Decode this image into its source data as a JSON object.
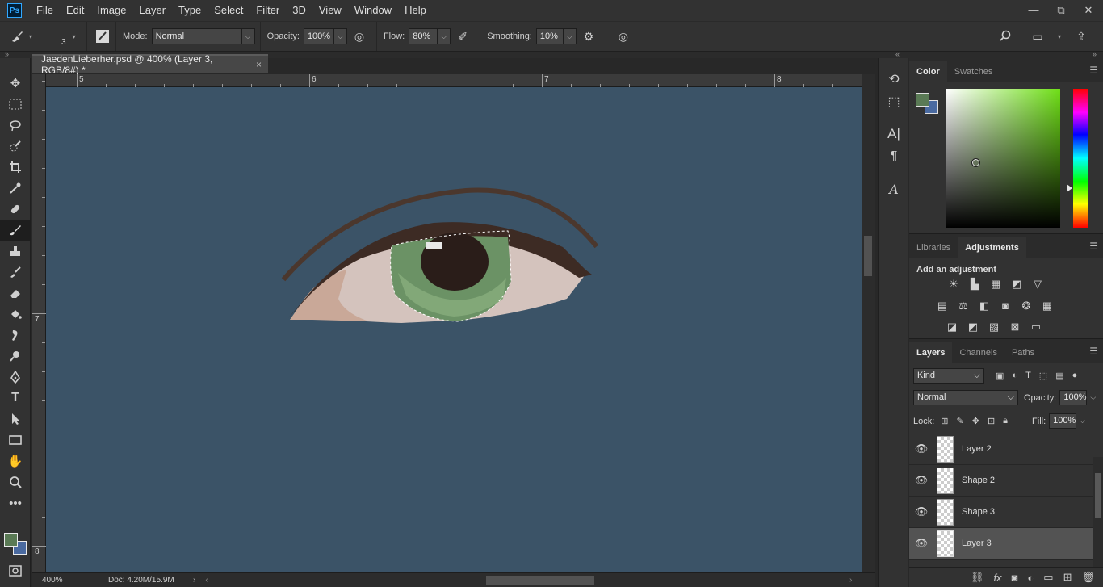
{
  "menubar": {
    "logo": "Ps",
    "items": [
      "File",
      "Edit",
      "Image",
      "Layer",
      "Type",
      "Select",
      "Filter",
      "3D",
      "View",
      "Window",
      "Help"
    ],
    "window_controls": [
      "—",
      "⧉",
      "✕"
    ]
  },
  "options": {
    "brush_size": "3",
    "mode_label": "Mode:",
    "mode_value": "Normal",
    "opacity_label": "Opacity:",
    "opacity_value": "100%",
    "flow_label": "Flow:",
    "flow_value": "80%",
    "smoothing_label": "Smoothing:",
    "smoothing_value": "10%"
  },
  "document": {
    "tab_title": "JaedenLieberher.psd @ 400% (Layer 3, RGB/8#) *",
    "tab_close": "×",
    "ruler_top": [
      "5",
      "6",
      "7",
      "8"
    ],
    "ruler_left": [
      "7",
      "8"
    ],
    "status_zoom": "400%",
    "status_doc": "Doc: 4.20M/15.9M"
  },
  "colors": {
    "foreground": "#5a7a55",
    "background": "#4a6aa0",
    "canvas_bg": "#3b5367",
    "hue": "#6fdf17"
  },
  "tools": [
    "move-tool-icon",
    "marquee-tool-icon",
    "lasso-tool-icon",
    "quick-select-tool-icon",
    "crop-tool-icon",
    "eyedropper-tool-icon",
    "healing-brush-tool-icon",
    "brush-tool-icon",
    "clone-stamp-tool-icon",
    "history-brush-tool-icon",
    "eraser-tool-icon",
    "paint-bucket-tool-icon",
    "smudge-tool-icon",
    "dodge-tool-icon",
    "pen-tool-icon",
    "type-tool-icon",
    "path-select-tool-icon",
    "rectangle-tool-icon",
    "hand-tool-icon",
    "zoom-tool-icon",
    "more-tools-icon"
  ],
  "color_panel": {
    "tabs": [
      "Color",
      "Swatches"
    ]
  },
  "adjustments_panel": {
    "tabs": [
      "Libraries",
      "Adjustments"
    ],
    "title": "Add an adjustment"
  },
  "layers_panel": {
    "tabs": [
      "Layers",
      "Channels",
      "Paths"
    ],
    "filter_kind": "Kind",
    "blend_mode": "Normal",
    "opacity_label": "Opacity:",
    "opacity_value": "100%",
    "lock_label": "Lock:",
    "fill_label": "Fill:",
    "fill_value": "100%",
    "layers": [
      {
        "name": "Layer 2",
        "selected": false
      },
      {
        "name": "Shape 2",
        "selected": false
      },
      {
        "name": "Shape 3",
        "selected": false
      },
      {
        "name": "Layer 3",
        "selected": true
      }
    ]
  }
}
